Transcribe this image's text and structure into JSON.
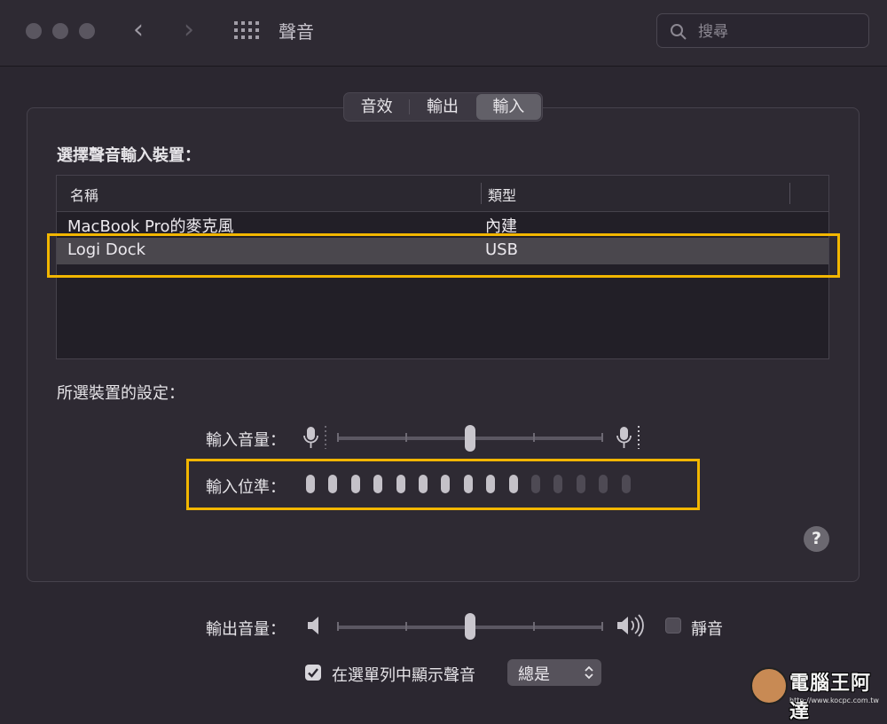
{
  "window": {
    "title": "聲音"
  },
  "search": {
    "placeholder": "搜尋"
  },
  "tabs": [
    {
      "label": "音效",
      "selected": false
    },
    {
      "label": "輸出",
      "selected": false
    },
    {
      "label": "輸入",
      "selected": true
    }
  ],
  "input_section": {
    "heading": "選擇聲音輸入裝置：",
    "columns": [
      "名稱",
      "類型"
    ],
    "devices": [
      {
        "name": "MacBook Pro的麥克風",
        "type": "內建",
        "selected": false
      },
      {
        "name": "Logi Dock",
        "type": "USB",
        "selected": true
      }
    ]
  },
  "settings": {
    "heading": "所選裝置的設定：",
    "input_volume_label": "輸入音量：",
    "input_volume_value": 0.5,
    "input_level_label": "輸入位準：",
    "input_level_active": 10,
    "input_level_total": 15
  },
  "output": {
    "volume_label": "輸出音量：",
    "volume_value": 0.5,
    "mute_label": "靜音",
    "mute_checked": false
  },
  "menubar": {
    "show_label": "在選單列中顯示聲音",
    "show_checked": true,
    "option_value": "總是"
  },
  "help_glyph": "?",
  "watermark": {
    "text": "電腦王阿達",
    "url": "http://www.kocpc.com.tw"
  },
  "colors": {
    "highlight": "#f2b600",
    "level_on": "#c4c1c8",
    "level_off": "#4e4a54"
  }
}
